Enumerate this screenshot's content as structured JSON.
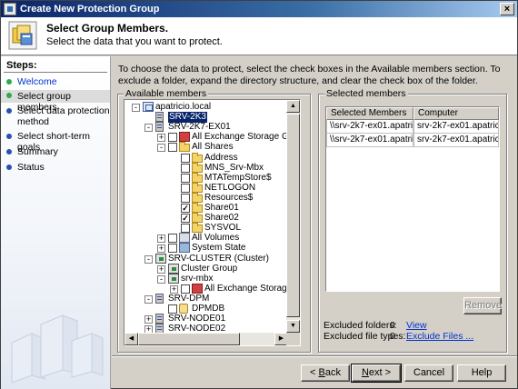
{
  "window": {
    "title": "Create New Protection Group",
    "close_glyph": "×"
  },
  "header": {
    "title": "Select Group Members.",
    "subtitle": "Select the data that you want to protect."
  },
  "sidebar": {
    "title": "Steps:",
    "steps": [
      {
        "label": "Welcome",
        "state": "link",
        "dot_color": "#2ea84a"
      },
      {
        "label": "Select group members",
        "state": "active",
        "dot_color": "#2ea84a"
      },
      {
        "label": "Select data protection method",
        "state": "pending",
        "dot_color": "#2b4fb0"
      },
      {
        "label": "Select short-term goals",
        "state": "pending",
        "dot_color": "#2b4fb0"
      },
      {
        "label": "Summary",
        "state": "pending",
        "dot_color": "#2b4fb0"
      },
      {
        "label": "Status",
        "state": "pending",
        "dot_color": "#2b4fb0"
      }
    ]
  },
  "intro_text": "To choose the data to protect, select the check boxes in the Available members section. To exclude a folder, expand the directory structure, and clear the check box of the folder.",
  "available": {
    "label": "Available members",
    "tree": [
      {
        "label": "apatricio.local",
        "icon": "domain-icon",
        "expander": "-",
        "checkbox": null,
        "depth": 0
      },
      {
        "label": "SRV-2K3",
        "icon": "server-icon",
        "expander": null,
        "checkbox": null,
        "depth": 1,
        "selected": true
      },
      {
        "label": "SRV-2K7-EX01",
        "icon": "server-icon",
        "expander": "-",
        "checkbox": null,
        "depth": 1
      },
      {
        "label": "All Exchange Storage Groups",
        "icon": "exchange-icon",
        "expander": "+",
        "checkbox": "unchecked",
        "depth": 2
      },
      {
        "label": "All Shares",
        "icon": "folder-icon",
        "expander": "-",
        "checkbox": "unchecked",
        "depth": 2
      },
      {
        "label": "Address",
        "icon": "folder-icon",
        "expander": null,
        "checkbox": "unchecked",
        "depth": 3
      },
      {
        "label": "MNS_Srv-Mbx",
        "icon": "folder-icon",
        "expander": null,
        "checkbox": "unchecked",
        "depth": 3
      },
      {
        "label": "MTATempStore$",
        "icon": "folder-icon",
        "expander": null,
        "checkbox": "unchecked",
        "depth": 3
      },
      {
        "label": "NETLOGON",
        "icon": "folder-icon",
        "expander": null,
        "checkbox": "unchecked",
        "depth": 3
      },
      {
        "label": "Resources$",
        "icon": "folder-icon",
        "expander": null,
        "checkbox": "unchecked",
        "depth": 3
      },
      {
        "label": "Share01",
        "icon": "folder-icon",
        "expander": null,
        "checkbox": "checked",
        "depth": 3
      },
      {
        "label": "Share02",
        "icon": "folder-icon",
        "expander": null,
        "checkbox": "checked",
        "depth": 3
      },
      {
        "label": "SYSVOL",
        "icon": "folder-icon",
        "expander": null,
        "checkbox": "unchecked",
        "depth": 3
      },
      {
        "label": "All Volumes",
        "icon": "volume-icon",
        "expander": "+",
        "checkbox": "unchecked",
        "depth": 2
      },
      {
        "label": "System State",
        "icon": "system-state-icon",
        "expander": "+",
        "checkbox": "unchecked",
        "depth": 2
      },
      {
        "label": "SRV-CLUSTER (Cluster)",
        "icon": "cluster-icon",
        "expander": "-",
        "checkbox": null,
        "depth": 1
      },
      {
        "label": "Cluster Group",
        "icon": "cluster-icon",
        "expander": "+",
        "checkbox": null,
        "depth": 2
      },
      {
        "label": "srv-mbx",
        "icon": "cluster-icon",
        "expander": "-",
        "checkbox": null,
        "depth": 2
      },
      {
        "label": "All Exchange Storage Groups",
        "icon": "exchange-icon",
        "expander": "+",
        "checkbox": "unchecked",
        "depth": 3
      },
      {
        "label": "SRV-DPM",
        "icon": "server-icon",
        "expander": "-",
        "checkbox": null,
        "depth": 1
      },
      {
        "label": "DPMDB",
        "icon": "database-icon",
        "expander": null,
        "checkbox": "unchecked",
        "depth": 2
      },
      {
        "label": "SRV-NODE01",
        "icon": "server-icon",
        "expander": "+",
        "checkbox": null,
        "depth": 1
      },
      {
        "label": "SRV-NODE02",
        "icon": "server-icon",
        "expander": "+",
        "checkbox": null,
        "depth": 1
      }
    ]
  },
  "selected": {
    "label": "Selected members",
    "columns": [
      "Selected Members",
      "Computer"
    ],
    "rows": [
      [
        "\\\\srv-2k7-ex01.apatrici...",
        "srv-2k7-ex01.apatricio.l..."
      ],
      [
        "\\\\srv-2k7-ex01.apatrici...",
        "srv-2k7-ex01.apatricio.l..."
      ]
    ],
    "remove_label": "Remove"
  },
  "excluded": {
    "folders_label": "Excluded folders:",
    "folders_count": "0",
    "folders_link": "View",
    "types_label": "Excluded file types:",
    "types_count": "0",
    "types_link": "Exclude Files ..."
  },
  "footer": {
    "back": {
      "pre": "< ",
      "key": "B",
      "post": "ack"
    },
    "next": {
      "pre": "",
      "key": "N",
      "post": "ext >"
    },
    "cancel": "Cancel",
    "help": "Help"
  }
}
